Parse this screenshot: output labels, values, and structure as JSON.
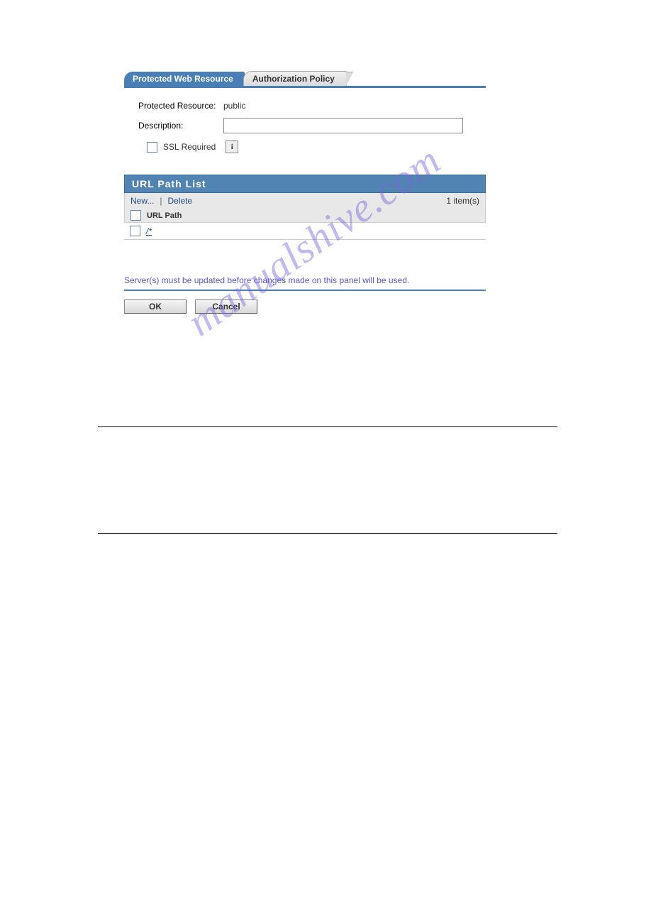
{
  "tabs": {
    "active": "Protected Web Resource",
    "inactive": "Authorization Policy"
  },
  "form": {
    "protectedResourceLabel": "Protected Resource:",
    "protectedResourceValue": "public",
    "descriptionLabel": "Description:",
    "descriptionValue": "",
    "sslLabel": "SSL Required",
    "infoGlyph": "i"
  },
  "urlPathList": {
    "title": "URL Path List",
    "newLabel": "New...",
    "deleteLabel": "Delete",
    "separator": "|",
    "itemCount": "1 item(s)",
    "columnHeader": "URL Path",
    "rows": [
      {
        "path": "/*"
      }
    ]
  },
  "notice": "Server(s) must be updated before changes made on this panel will be used.",
  "buttons": {
    "ok": "OK",
    "cancel": "Cancel"
  },
  "watermark": "manualshive.com"
}
